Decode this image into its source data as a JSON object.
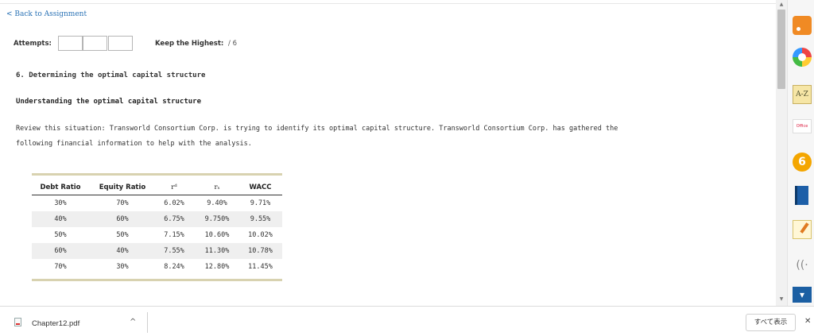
{
  "nav": {
    "back_link": "< Back to Assignment"
  },
  "attempts": {
    "label": "Attempts:",
    "keep_label": "Keep the Highest:",
    "keep_value": "/ 6"
  },
  "question": {
    "title": "6. Determining the optimal capital structure",
    "subtitle": "Understanding the optimal capital structure",
    "text_line1": "Review this situation: Transworld Consortium Corp. is trying to identify its optimal capital structure. Transworld Consortium Corp. has gathered the",
    "text_line2": "following financial information to help with the analysis."
  },
  "table": {
    "headers": [
      "Debt Ratio",
      "Equity Ratio",
      "rᵈ",
      "rₛ",
      "WACC"
    ],
    "rows": [
      [
        "30%",
        "70%",
        "6.02%",
        "9.40%",
        "9.71%"
      ],
      [
        "40%",
        "60%",
        "6.75%",
        "9.750%",
        "9.55%"
      ],
      [
        "50%",
        "50%",
        "7.15%",
        "10.60%",
        "10.02%"
      ],
      [
        "60%",
        "40%",
        "7.55%",
        "11.30%",
        "10.78%"
      ],
      [
        "70%",
        "30%",
        "8.24%",
        "12.80%",
        "11.45%"
      ]
    ]
  },
  "side_dock": {
    "icons": [
      "rss-icon",
      "chrome-icon",
      "a-z-dictionary-icon",
      "office-icon",
      "yellow-app-icon",
      "book-icon",
      "notepad-icon",
      "wifi-icon",
      "chevron-down-icon"
    ],
    "az_label": "A-Z",
    "office_label": "Office",
    "yellow_label": "6"
  },
  "download_bar": {
    "file_name": "Chapter12.pdf",
    "caret": "^",
    "show_all": "すべて表示",
    "close": "✕"
  }
}
